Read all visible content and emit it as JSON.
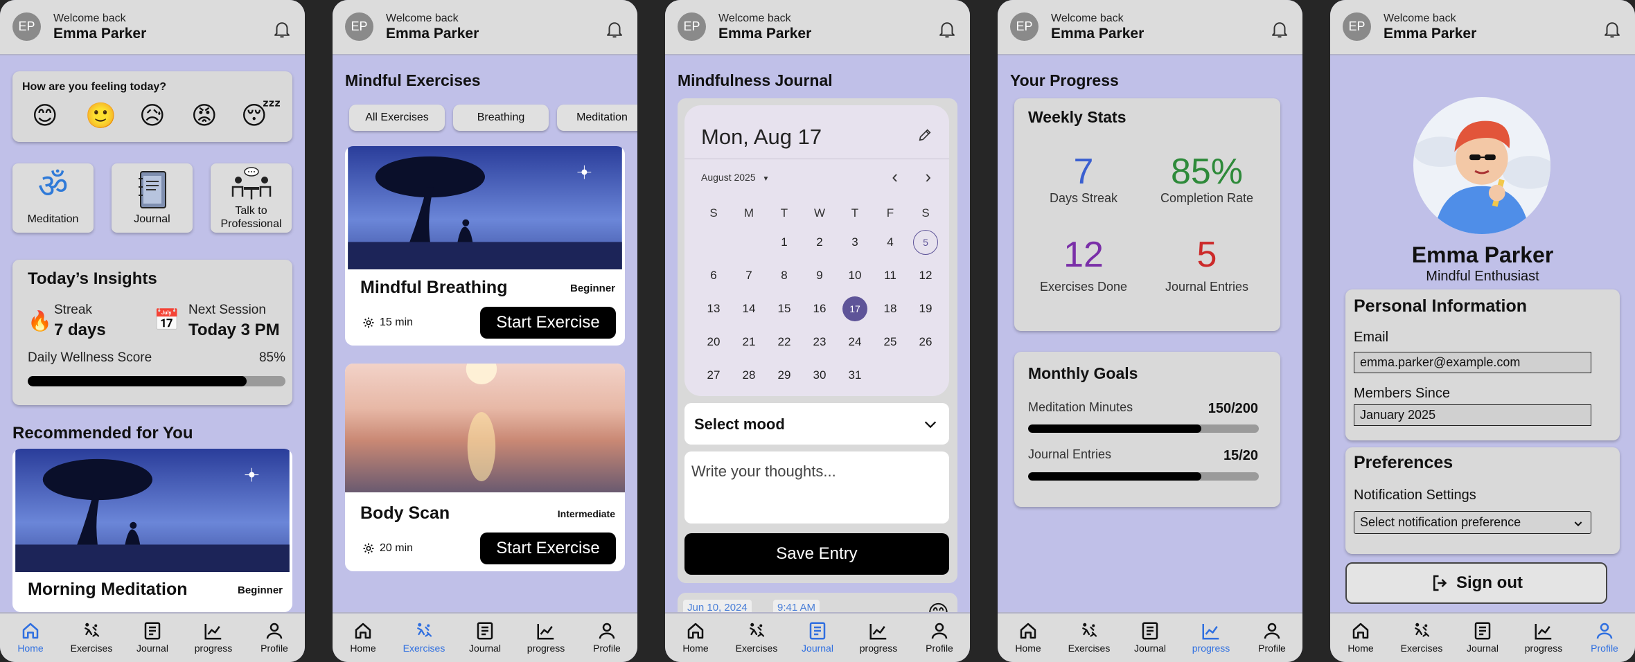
{
  "header": {
    "welcome": "Welcome back",
    "name": "Emma Parker",
    "initials": "EP"
  },
  "tabs": [
    "Home",
    "Exercises",
    "Journal",
    "progress",
    "Profile"
  ],
  "colors": {
    "accent": "#2f6fe0",
    "background": "#c0c0e8",
    "card": "#d9d9d9",
    "selected_day": "#5e5498"
  },
  "home": {
    "mood_question": "How are you feeling today?",
    "moods": [
      "😊",
      "🙂",
      "😥",
      "😡",
      "😴"
    ],
    "quick": [
      "Meditation",
      "Journal",
      "Talk to",
      "Professional"
    ],
    "insights_title": "Today’s Insights",
    "streak_label": "Streak",
    "streak_value": "7 days",
    "next_label": "Next Session",
    "next_value": "Today 3 PM",
    "wellness_label": "Daily Wellness Score",
    "wellness_value": "85%",
    "wellness_fraction": 0.85,
    "recommended_title": "Recommended for You",
    "rec_name": "Morning Meditation",
    "rec_level": "Beginner"
  },
  "exercises": {
    "title": "Mindful Exercises",
    "chips": [
      "All Exercises",
      "Breathing",
      "Meditation"
    ],
    "items": [
      {
        "name": "Mindful Breathing",
        "level": "Beginner",
        "duration": "15 min",
        "button": "Start Exercise"
      },
      {
        "name": "Body Scan",
        "level": "Intermediate",
        "duration": "20 min",
        "button": "Start Exercise"
      }
    ]
  },
  "journal": {
    "title": "Mindfulness Journal",
    "date": "Mon, Aug 17",
    "month": "August 2025",
    "dow": [
      "S",
      "M",
      "T",
      "W",
      "T",
      "F",
      "S"
    ],
    "days": [
      "1",
      "2",
      "3",
      "4",
      "5",
      "6",
      "7",
      "8",
      "9",
      "10",
      "11",
      "12",
      "13",
      "14",
      "15",
      "16",
      "17",
      "18",
      "19",
      "20",
      "21",
      "22",
      "23",
      "24",
      "25",
      "26",
      "27",
      "28",
      "29",
      "30",
      "31"
    ],
    "mood_select": "Select mood",
    "placeholder": "Write your thoughts...",
    "save": "Save Entry",
    "entry_date": "Jun 10, 2024",
    "entry_time": "9:41 AM"
  },
  "progress": {
    "title": "Your Progress",
    "weekly_title": "Weekly Stats",
    "stats": [
      {
        "value": "7",
        "label": "Days Streak",
        "color": "#3a5fd0"
      },
      {
        "value": "85%",
        "label": "Completion Rate",
        "color": "#2e8a3a"
      },
      {
        "value": "12",
        "label": "Exercises Done",
        "color": "#7a2fa8"
      },
      {
        "value": "5",
        "label": "Journal Entries",
        "color": "#cc2a2a"
      }
    ],
    "goals_title": "Monthly Goals",
    "goals": [
      {
        "label": "Meditation Minutes",
        "value": "150/200",
        "fraction": 0.75
      },
      {
        "label": "Journal Entries",
        "value": "15/20",
        "fraction": 0.75
      }
    ]
  },
  "profile": {
    "name": "Emma Parker",
    "subtitle": "Mindful Enthusiast",
    "personal_title": "Personal Information",
    "email_label": "Email",
    "email": "emma.parker@example.com",
    "member_label": "Members Since",
    "member": "January 2025",
    "pref_title": "Preferences",
    "notif_label": "Notification Settings",
    "notif_select": "Select notification preference",
    "signout": "Sign out"
  }
}
